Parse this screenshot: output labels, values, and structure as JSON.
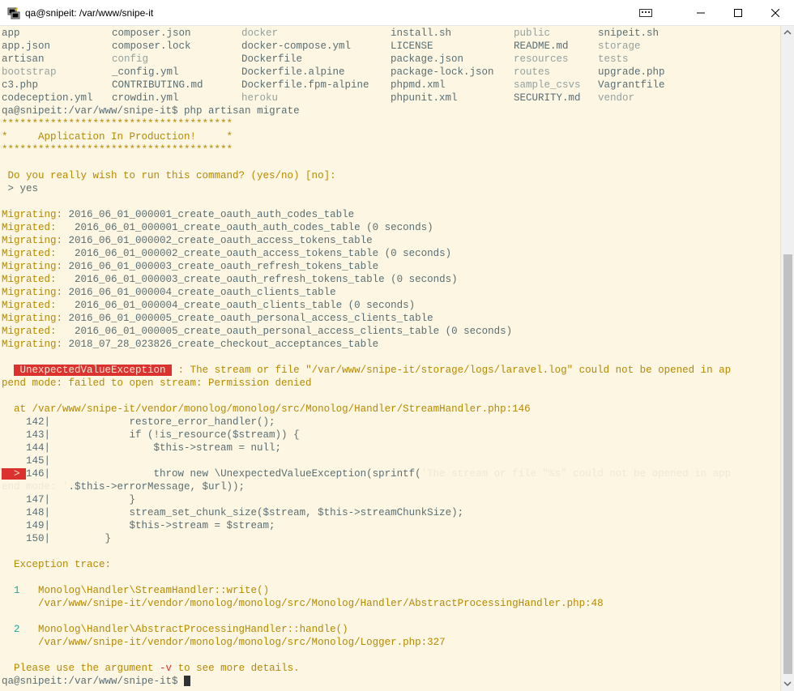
{
  "window": {
    "title": "qa@snipeit: /var/www/snipe-it"
  },
  "listing": [
    [
      "app",
      "composer.json",
      "docker",
      "install.sh",
      "public",
      "snipeit.sh"
    ],
    [
      "app.json",
      "composer.lock",
      "docker-compose.yml",
      "LICENSE",
      "README.md",
      "storage"
    ],
    [
      "artisan",
      "config",
      "Dockerfile",
      "package.json",
      "resources",
      "tests"
    ],
    [
      "bootstrap",
      "_config.yml",
      "Dockerfile.alpine",
      "package-lock.json",
      "routes",
      "upgrade.php"
    ],
    [
      "c3.php",
      "CONTRIBUTING.md",
      "Dockerfile.fpm-alpine",
      "phpmd.xml",
      "sample_csvs",
      "Vagrantfile"
    ],
    [
      "codeception.yml",
      "crowdin.yml",
      "heroku",
      "phpunit.xml",
      "SECURITY.md",
      "vendor"
    ]
  ],
  "prompt": "qa@snipeit:/var/www/snipe-it$",
  "command": " php artisan migrate",
  "banner": [
    "**************************************",
    "*     Application In Production!     *",
    "**************************************"
  ],
  "confirm": {
    "question": " Do you really wish to run this command? (yes/no) [no]:",
    "answer": " > yes"
  },
  "migrations": [
    [
      "Migrating:",
      " 2016_06_01_000001_create_oauth_auth_codes_table"
    ],
    [
      "Migrated: ",
      "  2016_06_01_000001_create_oauth_auth_codes_table (0 seconds)"
    ],
    [
      "Migrating:",
      " 2016_06_01_000002_create_oauth_access_tokens_table"
    ],
    [
      "Migrated: ",
      "  2016_06_01_000002_create_oauth_access_tokens_table (0 seconds)"
    ],
    [
      "Migrating:",
      " 2016_06_01_000003_create_oauth_refresh_tokens_table"
    ],
    [
      "Migrated: ",
      "  2016_06_01_000003_create_oauth_refresh_tokens_table (0 seconds)"
    ],
    [
      "Migrating:",
      " 2016_06_01_000004_create_oauth_clients_table"
    ],
    [
      "Migrated: ",
      "  2016_06_01_000004_create_oauth_clients_table (0 seconds)"
    ],
    [
      "Migrating:",
      " 2016_06_01_000005_create_oauth_personal_access_clients_table"
    ],
    [
      "Migrated: ",
      "  2016_06_01_000005_create_oauth_personal_access_clients_table (0 seconds)"
    ],
    [
      "Migrating:",
      " 2018_07_28_023826_create_checkout_acceptances_table"
    ]
  ],
  "error": {
    "badge": " UnexpectedValueException ",
    "message1": " : The stream or file \"/var/www/snipe-it/storage/logs/laravel.log\" could not be opened in ap",
    "message2": "pend mode: failed to open stream: Permission denied",
    "at_label": "  at ",
    "at_path": "/var/www/snipe-it/vendor/monolog/monolog/src/Monolog/Handler/StreamHandler.php",
    "at_line": ":146"
  },
  "code": [
    {
      "num": "    142|",
      "code": "             restore_error_handler();"
    },
    {
      "num": "    143|",
      "code": "             if (!is_resource($stream)) {"
    },
    {
      "num": "    144|",
      "code": "                 $this->stream = null;"
    },
    {
      "num": "    145|",
      "code": ""
    },
    {
      "marker": "  > ",
      "num": "146|",
      "pre": "                 throw new \\UnexpectedValueException(sprintf(",
      "str": "'The stream or file \"%s\" could not be opened in app"
    },
    {
      "num": "",
      "str2": "end mode: '",
      "post": ".$this->errorMessage, $url));"
    },
    {
      "num": "    147|",
      "code": "             }"
    },
    {
      "num": "    148|",
      "code": "             stream_set_chunk_size($stream, $this->streamChunkSize);"
    },
    {
      "num": "    149|",
      "code": "             $this->stream = $stream;"
    },
    {
      "num": "    150|",
      "code": "         }"
    }
  ],
  "trace": {
    "title": "  Exception trace:",
    "items": [
      {
        "n": "  1",
        "fn": "   Monolog\\Handler\\StreamHandler::write()",
        "path": "      /var/www/snipe-it/vendor/monolog/monolog/src/Monolog/Handler/AbstractProcessingHandler.php",
        "line": ":48"
      },
      {
        "n": "  2",
        "fn": "   Monolog\\Handler\\AbstractProcessingHandler::handle()",
        "path": "      /var/www/snipe-it/vendor/monolog/monolog/src/Monolog/Logger.php",
        "line": ":327"
      }
    ]
  },
  "hint": {
    "pre": "  Please use the argument ",
    "flag": "-v",
    "post": " to see more details."
  },
  "final_prompt": "qa@snipeit:/var/www/snipe-it$ "
}
